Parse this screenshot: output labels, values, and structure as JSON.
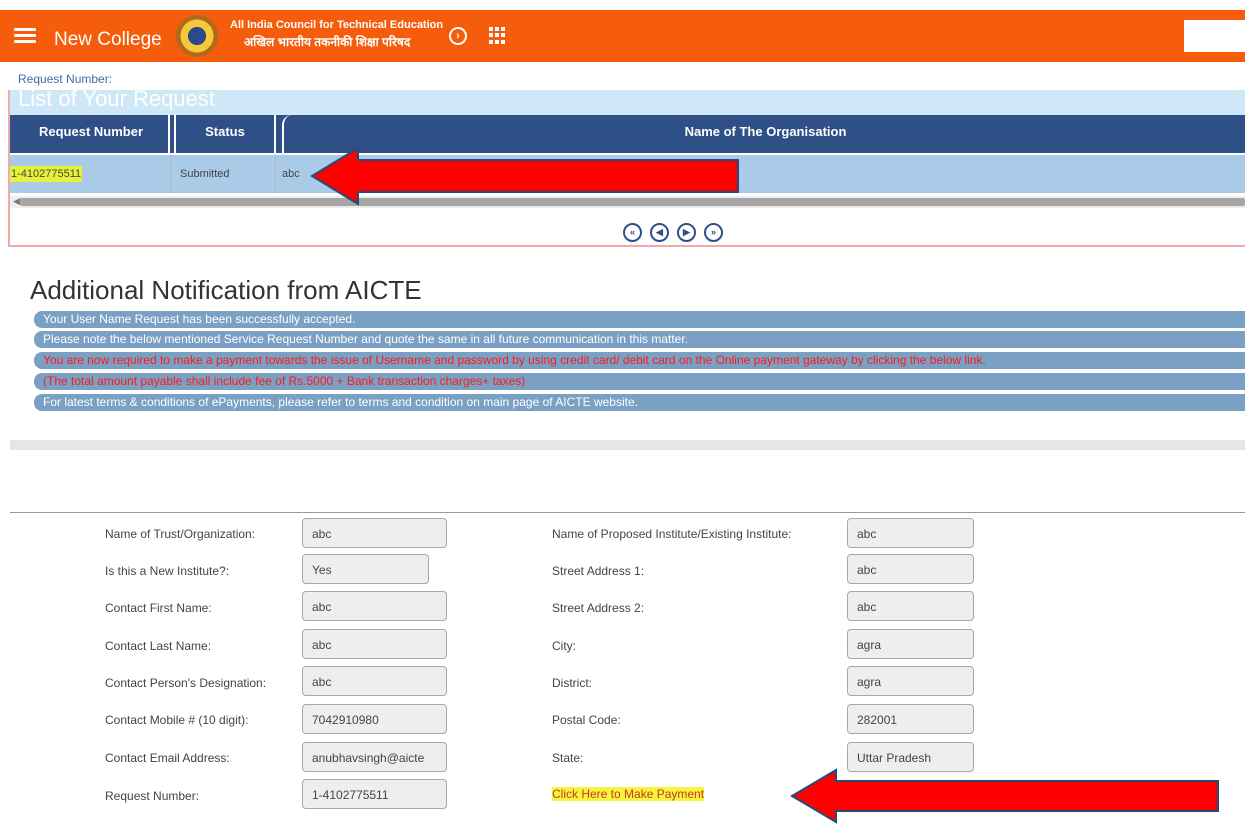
{
  "header": {
    "app_name": "New College",
    "org_name_en": "All India Council for Technical Education",
    "org_name_hi": "अखिल भारतीय तकनीकी शिक्षा परिषद",
    "logo_text": "AICTE",
    "icons": [
      "menu-icon",
      "chevron-right-circle-icon",
      "apps-grid-icon"
    ],
    "brand_color": "#f55d0d"
  },
  "request_label": "Request Number:",
  "request_list": {
    "title": "List of Your Request",
    "columns": [
      "Request Number",
      "Status",
      "Name of The Organisation"
    ],
    "rows": [
      {
        "request_number": "1-4102775511",
        "status": "Submitted",
        "organisation": "abc"
      }
    ],
    "pager_icons": [
      "first-page-icon",
      "prev-page-icon",
      "next-page-icon",
      "last-page-icon"
    ],
    "pager_glyphs": [
      "«",
      "◀",
      "▶",
      "»"
    ]
  },
  "notification": {
    "title": "Additional Notification from AICTE",
    "lines": [
      {
        "text": "Your User Name Request has been successfully accepted.",
        "color": "#ffffff"
      },
      {
        "text": "Please note the below mentioned Service Request Number and quote the same in all future communication in this matter.",
        "color": "#ffffff"
      },
      {
        "text": "You are now required to make a payment towards the issue of Username and password by using credit card/ debit card on the Online payment gateway by clicking the below link.",
        "color": "#ff1a1a"
      },
      {
        "text": "(The total amount payable shall include fee of Rs.5000 + Bank transaction charges+ taxes)",
        "color": "#ff1a1a"
      },
      {
        "text": "For latest terms & conditions of ePayments, please refer to terms and condition on main page of AICTE website.",
        "color": "#ffffff"
      }
    ]
  },
  "form": {
    "left": [
      {
        "label": "Name of Trust/Organization:",
        "value": "abc"
      },
      {
        "label": "Is this a New Institute?:",
        "value": "Yes"
      },
      {
        "label": "Contact First Name:",
        "value": "abc"
      },
      {
        "label": "Contact Last Name:",
        "value": "abc"
      },
      {
        "label": "Contact Person's Designation:",
        "value": "abc"
      },
      {
        "label": "Contact Mobile # (10 digit):",
        "value": "7042910980"
      },
      {
        "label": "Contact Email Address:",
        "value": "anubhavsingh@aicte"
      },
      {
        "label": "Request Number:",
        "value": "1-4102775511"
      }
    ],
    "right": [
      {
        "label": "Name of Proposed Institute/Existing Institute:",
        "value": "abc"
      },
      {
        "label": "Street Address 1:",
        "value": "abc"
      },
      {
        "label": "Street Address 2:",
        "value": "abc"
      },
      {
        "label": "City:",
        "value": "agra"
      },
      {
        "label": "District:",
        "value": "agra"
      },
      {
        "label": "Postal Code:",
        "value": "282001"
      },
      {
        "label": "State:",
        "value": "Uttar Pradesh"
      }
    ],
    "payment_link": "Click Here to Make Payment"
  },
  "annotation_colors": {
    "arrow": "#ff0000",
    "highlight": "#f5f53a"
  }
}
